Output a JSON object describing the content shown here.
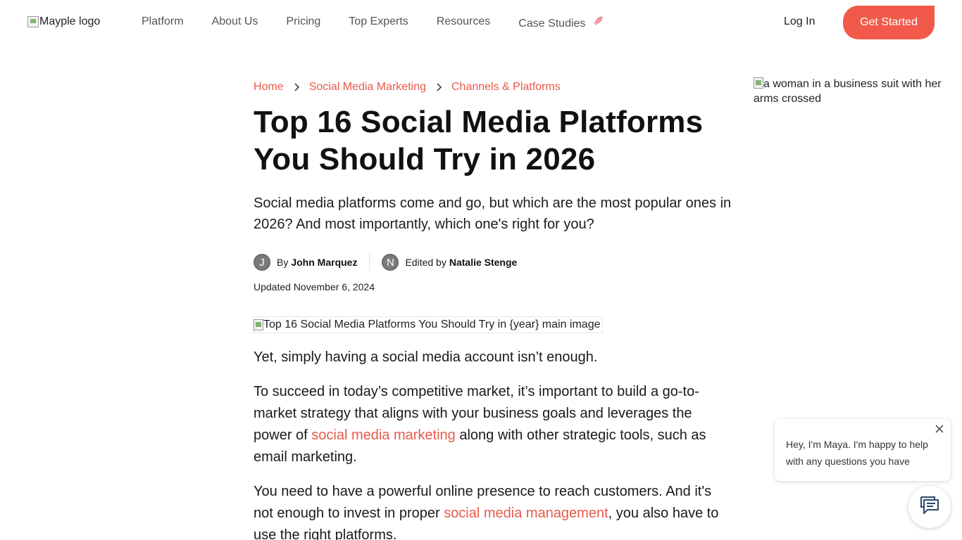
{
  "header": {
    "logo_alt": "Mayple logo",
    "nav": [
      {
        "label": "Platform"
      },
      {
        "label": "About Us"
      },
      {
        "label": "Pricing"
      },
      {
        "label": "Top Experts"
      },
      {
        "label": "Resources"
      },
      {
        "label": "Case Studies",
        "icon": "rocket-icon"
      }
    ],
    "login_label": "Log In",
    "cta_label": "Get Started"
  },
  "breadcrumb": [
    {
      "label": "Home"
    },
    {
      "label": "Social Media Marketing"
    },
    {
      "label": "Channels & Platforms"
    }
  ],
  "article": {
    "title_line1": "Top 16 Social Media Platforms",
    "title_line2": "You Should Try in 2026",
    "lead": "Social media platforms come and go, but which are the most popular ones in 2026? And most importantly, which one's right for you?",
    "author": {
      "initial": "J",
      "prefix": "By",
      "name": "John Marquez"
    },
    "editor": {
      "initial": "N",
      "prefix": "Edited by",
      "name": "Natalie Stenge"
    },
    "updated": "Updated November 6, 2024",
    "main_image_alt": "Top 16 Social Media Platforms You Should Try in {year} main image",
    "p1": "Yet, simply having a social media account isn’t enough.",
    "p2_before": "To succeed in today’s competitive market, it’s important to build a go-to-market strategy that aligns with your business goals and leverages the power of ",
    "p2_link": "social media marketing",
    "p2_after": " along with other strategic tools, such as email marketing.",
    "p3_before": "You need to have a powerful online presence to reach customers. And it's not enough to invest in proper ",
    "p3_link": "social media management",
    "p3_after": ", you also have to use the right platforms."
  },
  "side_image_alt": "a woman in a business suit with her arms crossed",
  "chat": {
    "message": "Hey, I'm Maya. I'm happy to help with any questions you have"
  },
  "colors": {
    "accent": "#f15a4a",
    "link": "#e8594a"
  }
}
